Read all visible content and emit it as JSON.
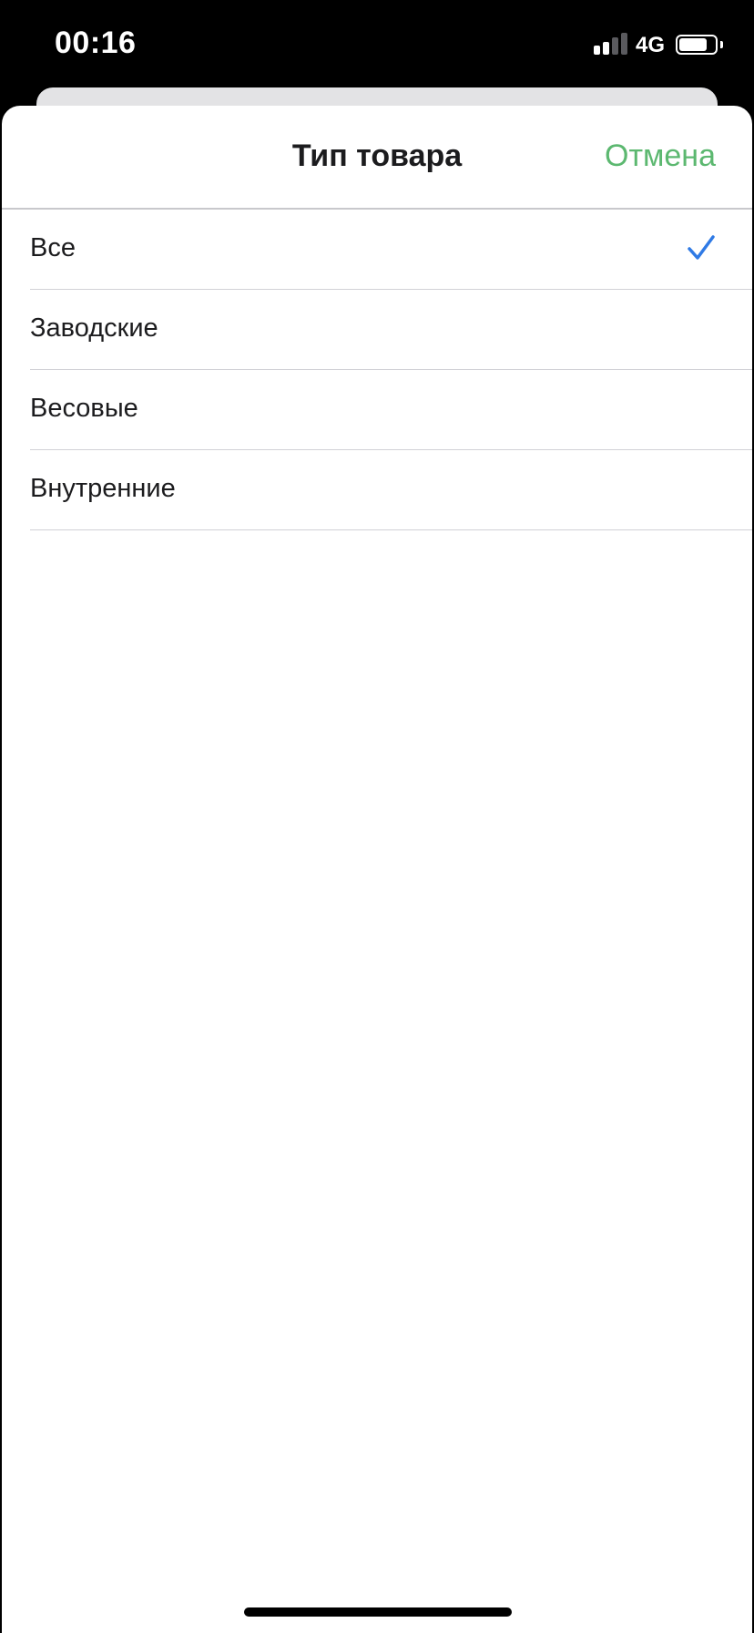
{
  "status_bar": {
    "time": "00:16",
    "network": "4G",
    "signal_bars_filled": 2,
    "signal_bars_total": 4,
    "battery_level": 0.8
  },
  "sheet": {
    "title": "Тип товара",
    "cancel_label": "Отмена"
  },
  "options": [
    {
      "label": "Все",
      "selected": true
    },
    {
      "label": "Заводские",
      "selected": false
    },
    {
      "label": "Весовые",
      "selected": false
    },
    {
      "label": "Внутренние",
      "selected": false
    }
  ],
  "icons": {
    "check": "checkmark-icon",
    "signal": "cellular-signal-icon",
    "battery": "battery-icon"
  },
  "colors": {
    "accent_green": "#5cb870",
    "check_blue": "#2f7ae5",
    "separator": "#d1d1d6"
  }
}
